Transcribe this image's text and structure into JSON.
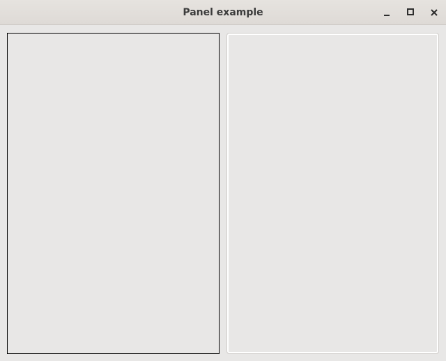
{
  "window": {
    "title": "Panel example"
  },
  "controls": {
    "minimize": "minimize-icon",
    "maximize": "maximize-icon",
    "close": "close-icon"
  },
  "colors": {
    "background": "#e8e7e6",
    "titlebar": "#dedad6",
    "title_text": "#3c3c3c",
    "left_panel_border": "#000000",
    "right_panel_border": "#ffffff"
  }
}
